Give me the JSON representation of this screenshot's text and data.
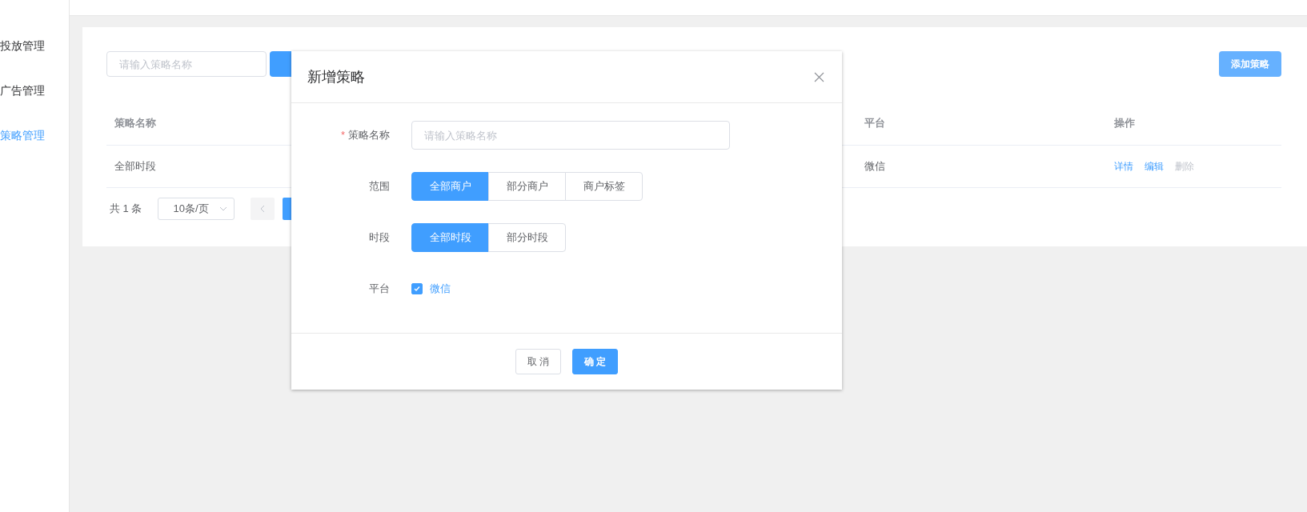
{
  "sidebar": {
    "items": [
      {
        "label": "投放管理",
        "selected": false
      },
      {
        "label": "广告管理",
        "selected": false
      },
      {
        "label": "策略管理",
        "selected": true
      }
    ]
  },
  "toolbar": {
    "search": {
      "placeholder": "请输入策略名称"
    },
    "add_button": "添加策略"
  },
  "table": {
    "columns": [
      "策略名称",
      "平台",
      "操作"
    ],
    "rows": [
      {
        "cells": [
          "全部时段",
          "微信"
        ],
        "actions": [
          {
            "label": "详情",
            "disabled": false
          },
          {
            "label": "编辑",
            "disabled": false
          },
          {
            "label": "删除",
            "disabled": true
          }
        ]
      }
    ]
  },
  "pagination": {
    "total": "共 1 条",
    "page_size": "10条/页"
  },
  "dialog": {
    "title": "新增策略",
    "fields": [
      {
        "kind": "input",
        "required_mark": "*",
        "label": "策略名称",
        "placeholder": "请输入策略名称"
      },
      {
        "kind": "segmented",
        "label": "范围",
        "options": [
          {
            "label": "全部商户",
            "selected": true
          },
          {
            "label": "部分商户",
            "selected": false
          },
          {
            "label": "商户标签",
            "selected": false
          }
        ]
      },
      {
        "kind": "segmented",
        "label": "时段",
        "options": [
          {
            "label": "全部时段",
            "selected": true
          },
          {
            "label": "部分时段",
            "selected": false
          }
        ]
      },
      {
        "kind": "checkbox",
        "label": "平台",
        "options": [
          {
            "label": "微信",
            "checked": true
          }
        ]
      }
    ],
    "buttons": [
      {
        "label": "取 消",
        "primary": false
      },
      {
        "label": "确 定",
        "primary": true
      }
    ]
  }
}
